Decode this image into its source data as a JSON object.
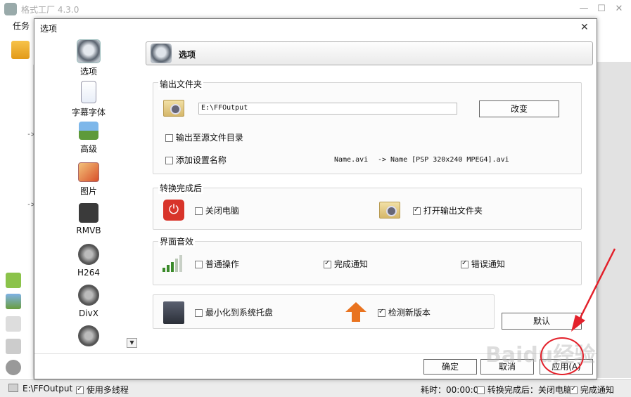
{
  "main_window": {
    "title": "格式工厂 4.3.0",
    "menu_task": "任务",
    "arrow_labels": [
      "->",
      "->"
    ],
    "controls": {
      "min": "—",
      "max": "☐",
      "close": "✕"
    }
  },
  "dialog": {
    "title": "选项",
    "close": "✕",
    "header_label": "选项",
    "nav": [
      {
        "label": "选项",
        "icon": "options-icon"
      },
      {
        "label": "字幕字体",
        "icon": "subtitle-font-icon"
      },
      {
        "label": "高级",
        "icon": "advanced-icon"
      },
      {
        "label": "图片",
        "icon": "picture-icon"
      },
      {
        "label": "RMVB",
        "icon": "rmvb-icon"
      },
      {
        "label": "H264",
        "icon": "h264-icon"
      },
      {
        "label": "DivX",
        "icon": "divx-icon"
      },
      {
        "label": "",
        "icon": "film-reel-icon"
      }
    ],
    "output_folder": {
      "title": "输出文件夹",
      "path": "E:\\FFOutput",
      "change_btn": "改变",
      "to_source_dir": {
        "label": "输出至源文件目录",
        "checked": false
      },
      "add_setting_name": {
        "label": "添加设置名称",
        "checked": false
      },
      "example_src": "Name.avi",
      "example_dst": "-> Name [PSP 320x240 MPEG4].avi"
    },
    "after_convert": {
      "title": "转换完成后",
      "shutdown": {
        "label": "关闭电脑",
        "checked": false
      },
      "open_output": {
        "label": "打开输出文件夹",
        "checked": true
      }
    },
    "sound": {
      "title": "界面音效",
      "normal": {
        "label": "普通操作",
        "checked": false
      },
      "complete": {
        "label": "完成通知",
        "checked": true
      },
      "error": {
        "label": "错误通知",
        "checked": true
      }
    },
    "misc": {
      "minimize_tray": {
        "label": "最小化到系统托盘",
        "checked": false
      },
      "check_update": {
        "label": "检测新版本",
        "checked": true
      }
    },
    "default_btn": "默认",
    "ok_btn": "确定",
    "cancel_btn": "取消",
    "apply_btn": "应用(A)"
  },
  "statusbar": {
    "path": "E:\\FFOutput",
    "multithread": {
      "label": "使用多线程",
      "checked": true
    },
    "elapsed": "耗时：00:00:00",
    "after_done": "转换完成后：关闭电脑",
    "notify": {
      "label": "完成通知",
      "checked": true
    }
  },
  "watermark": "Baidu经验",
  "colors": {
    "annotation_red": "#e3212b",
    "power_red": "#d8342a",
    "update_orange": "#e9731f"
  }
}
